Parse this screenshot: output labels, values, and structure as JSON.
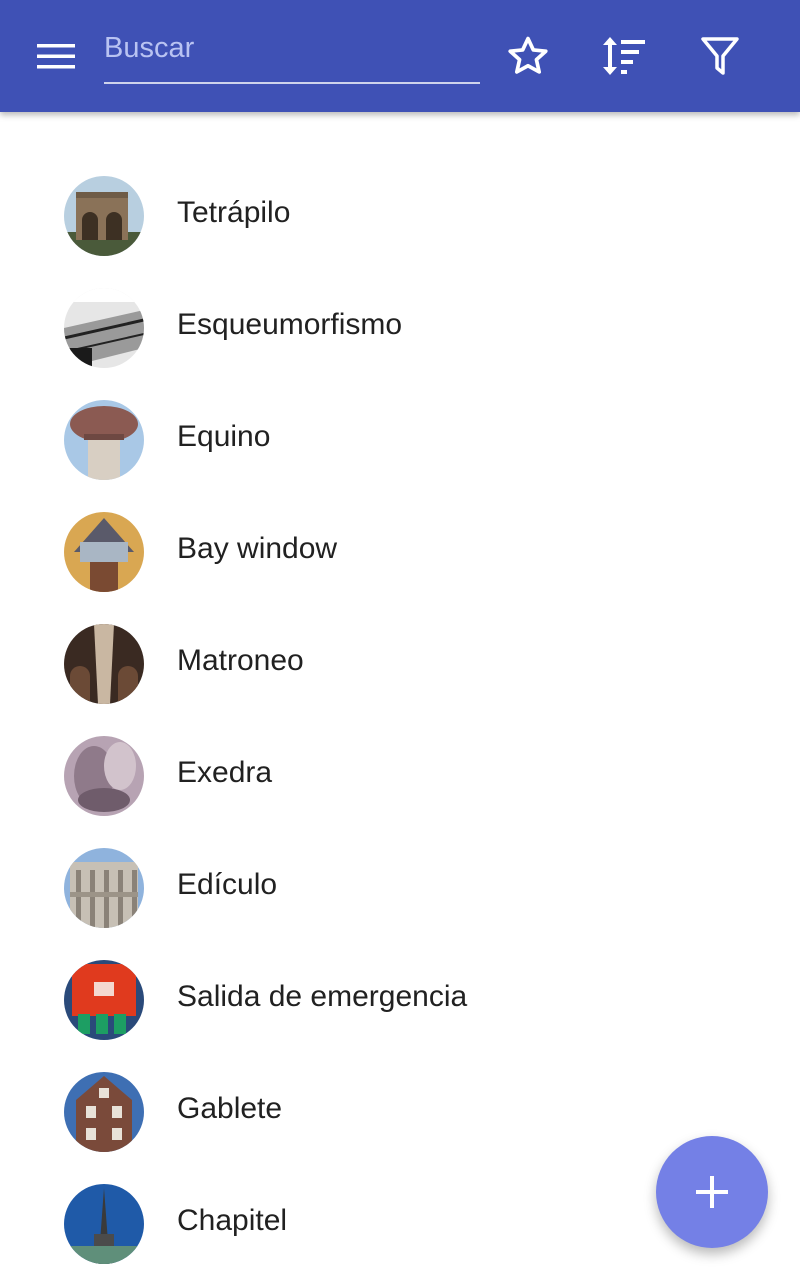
{
  "toolbar": {
    "menu_icon": "menu-icon",
    "search": {
      "placeholder": "Buscar",
      "value": ""
    },
    "actions": [
      {
        "name": "favorites",
        "icon": "star-icon"
      },
      {
        "name": "sort",
        "icon": "sort-icon"
      },
      {
        "name": "filter",
        "icon": "filter-icon"
      }
    ],
    "color": "#3f51b5"
  },
  "list": {
    "items": [
      {
        "label": "Tetrápilo"
      },
      {
        "label": "Esqueumorfismo"
      },
      {
        "label": "Equino"
      },
      {
        "label": "Bay window"
      },
      {
        "label": "Matroneo"
      },
      {
        "label": "Exedra"
      },
      {
        "label": "Edículo"
      },
      {
        "label": "Salida de emergencia"
      },
      {
        "label": "Gablete"
      },
      {
        "label": "Chapitel"
      }
    ]
  },
  "fab": {
    "icon": "plus-icon",
    "color": "#7480e6"
  }
}
